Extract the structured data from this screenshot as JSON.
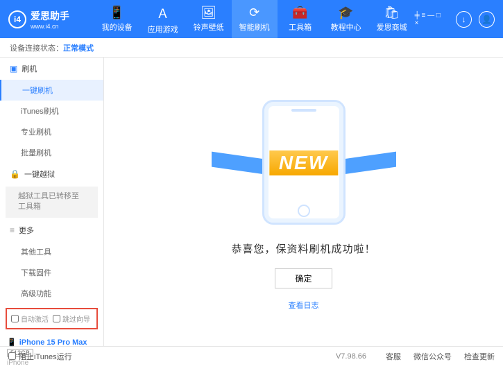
{
  "header": {
    "logo_title": "爱思助手",
    "logo_sub": "www.i4.cn",
    "nav": [
      {
        "label": "我的设备",
        "icon": "📱"
      },
      {
        "label": "应用游戏",
        "icon": "Ａ"
      },
      {
        "label": "铃声壁纸",
        "icon": "🖼"
      },
      {
        "label": "智能刷机",
        "icon": "⟳",
        "active": true
      },
      {
        "label": "工具箱",
        "icon": "🧰"
      },
      {
        "label": "教程中心",
        "icon": "🎓"
      },
      {
        "label": "爱思商城",
        "icon": "🛍"
      }
    ],
    "win_controls": "╪ ≡ — □ ×",
    "download_icon": "↓",
    "user_icon": "👤"
  },
  "status": {
    "label": "设备连接状态：",
    "mode": "正常模式"
  },
  "sidebar": {
    "flash_head": "刷机",
    "items_flash": [
      "一键刷机",
      "iTunes刷机",
      "专业刷机",
      "批量刷机"
    ],
    "jailbreak_head": "一键越狱",
    "jailbreak_sub": "越狱工具已转移至工具箱",
    "more_head": "更多",
    "items_more": [
      "其他工具",
      "下载固件",
      "高级功能"
    ],
    "checks": {
      "auto_activate": "自动激活",
      "skip_guide": "跳过向导"
    },
    "device": {
      "name": "iPhone 15 Pro Max",
      "capacity": "512GB",
      "type": "iPhone"
    }
  },
  "main": {
    "new_text": "NEW",
    "success": "恭喜您，保资料刷机成功啦！",
    "ok": "确定",
    "view_log": "查看日志"
  },
  "footer": {
    "block_itunes": "阻止iTunes运行",
    "version": "V7.98.66",
    "links": [
      "客服",
      "微信公众号",
      "检查更新"
    ]
  }
}
